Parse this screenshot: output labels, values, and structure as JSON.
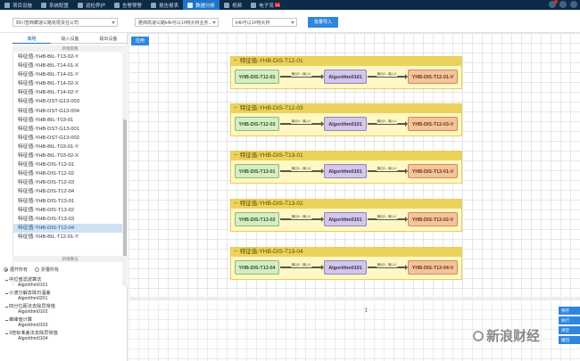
{
  "nav": {
    "items": [
      {
        "label": "项目设施",
        "active": false
      },
      {
        "label": "系统配置",
        "active": false
      },
      {
        "label": "巡检养护",
        "active": false
      },
      {
        "label": "告警预警",
        "active": false
      },
      {
        "label": "报告报表",
        "active": false
      },
      {
        "label": "数据分析",
        "active": true
      },
      {
        "label": "视频",
        "active": false
      },
      {
        "label": "电子流",
        "active": false
      }
    ],
    "badge": "14"
  },
  "filters": {
    "company": "四川智西藏速公路有限责任公司",
    "route": "雅西高速公路k4k可以1#特大桥业务...",
    "bridge": "k4k可以1#特大桥",
    "import_button": "批量导入"
  },
  "left": {
    "tabs": [
      {
        "label": "策略",
        "active": true
      },
      {
        "label": "输入设备",
        "active": false
      },
      {
        "label": "输出设备",
        "active": false
      }
    ],
    "new_strategy": "新增策略",
    "strategies": [
      "特征值-YHB-BIL-T13-02-Y",
      "特征值-YHB-BIL-T14-01-X",
      "特征值-YHB-BIL-T14-01-Y",
      "特征值-YHB-BIL-T14-02-X",
      "特征值-YHB-BIL-T14-02-Y",
      "特征值-YHB-DST-G13-003",
      "特征值-YHB-DST-G13-004",
      "特征值-YHB-BIL-T03-01",
      "特征值-YHB-DST-G13-001",
      "特征值-YHB-DST-G13-002",
      "特征值-YHB-BIL-T03-01-Y",
      "特征值-YHB-BIL-T03-02-X",
      "特征值-YHB-DIS-T12-01",
      "特征值-YHB-DIS-T12-02",
      "特征值-YHB-DIS-T12-03",
      "特征值-YHB-DIS-T12-04",
      "特征值-YHB-DIS-T13-01",
      "特征值-YHB-DIS-T13-02",
      "特征值-YHB-DIS-T13-03",
      "特征值-YHB-DIS-T13-04",
      "特征值-YHB-BIL-T12-01-Y"
    ],
    "selected_index": 19,
    "new_algorithm": "新增算法",
    "expand_all": "展开所有",
    "collapse_all": "折叠所有",
    "algorithms": [
      {
        "name": "中位值滤波算法",
        "code": "Algorithm0101"
      },
      {
        "name": "小波分解去除日温差",
        "code": "Algorithm0201"
      },
      {
        "name": "四分位距法去除异常值",
        "code": "Algorithm0102"
      },
      {
        "name": "峰峰值计算",
        "code": "Algorithm0103"
      },
      {
        "name": "3倍标准差法去除异常值",
        "code": "Algorithm0104"
      }
    ]
  },
  "canvas": {
    "apply_button": "应用",
    "groups": [
      {
        "title": "特征值-YHB-DIS-T12-01",
        "source": "YHB-DIS-T12-01",
        "algorithm": "Algorithm0101",
        "output": "YHB-DIS-T12-01-V",
        "edge_in": "输出0→输入0",
        "edge_out": "输出0→输入0"
      },
      {
        "title": "特征值-YHB-DIS-T12-03",
        "source": "YHB-DIS-T12-03",
        "algorithm": "Algorithm0101",
        "output": "YHB-DIS-T12-03-V",
        "edge_in": "输出0→输入0",
        "edge_out": "输出0→输入0"
      },
      {
        "title": "特征值-YHB-DIS-T13-01",
        "source": "YHB-DIS-T13-01",
        "algorithm": "Algorithm0101",
        "output": "YHB-DIS-T13-01-V",
        "edge_in": "输出0→输入0",
        "edge_out": "输出0→输入0"
      },
      {
        "title": "特征值-YHB-DIS-T13-02",
        "source": "YHB-DIS-T13-02",
        "algorithm": "Algorithm0101",
        "output": "YHB-DIS-T13-02-V",
        "edge_in": "输出0→输入0",
        "edge_out": "输出0→输入0"
      },
      {
        "title": "特征值-YHB-DIS-T13-04",
        "source": "YHB-DIS-T13-04",
        "algorithm": "Algorithm0101",
        "output": "YHB-DIS-T13-04-V",
        "edge_in": "输出0→输入0",
        "edge_out": "输出0→输入0"
      }
    ],
    "side_tabs": [
      "保存",
      "执行",
      "清空",
      "撤回"
    ]
  },
  "watermark": "新浪财经"
}
